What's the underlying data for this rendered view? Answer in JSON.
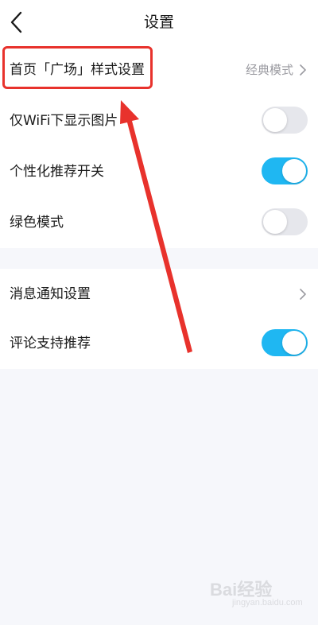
{
  "header": {
    "title": "设置",
    "back_icon": "chevron-left-icon"
  },
  "rows": [
    {
      "label": "首页「广场」样式设置",
      "value": "经典模式",
      "type": "nav",
      "icon": "chevron-right-icon"
    },
    {
      "label": "仅WiFi下显示图片",
      "type": "toggle",
      "on": false
    },
    {
      "label": "个性化推荐开关",
      "type": "toggle",
      "on": true
    },
    {
      "label": "绿色模式",
      "type": "toggle",
      "on": false
    },
    {
      "label": "消息通知设置",
      "type": "nav",
      "icon": "chevron-right-icon"
    },
    {
      "label": "评论支持推荐",
      "type": "toggle",
      "on": true
    }
  ],
  "annotation": {
    "color": "#e8322c"
  },
  "watermark": {
    "logo": "Bai经验",
    "sub": "jingyan.baidu.com"
  },
  "colors": {
    "accent": "#1fb7f2",
    "toggle_off": "#e6e7ec",
    "background": "#f6f7fb"
  }
}
